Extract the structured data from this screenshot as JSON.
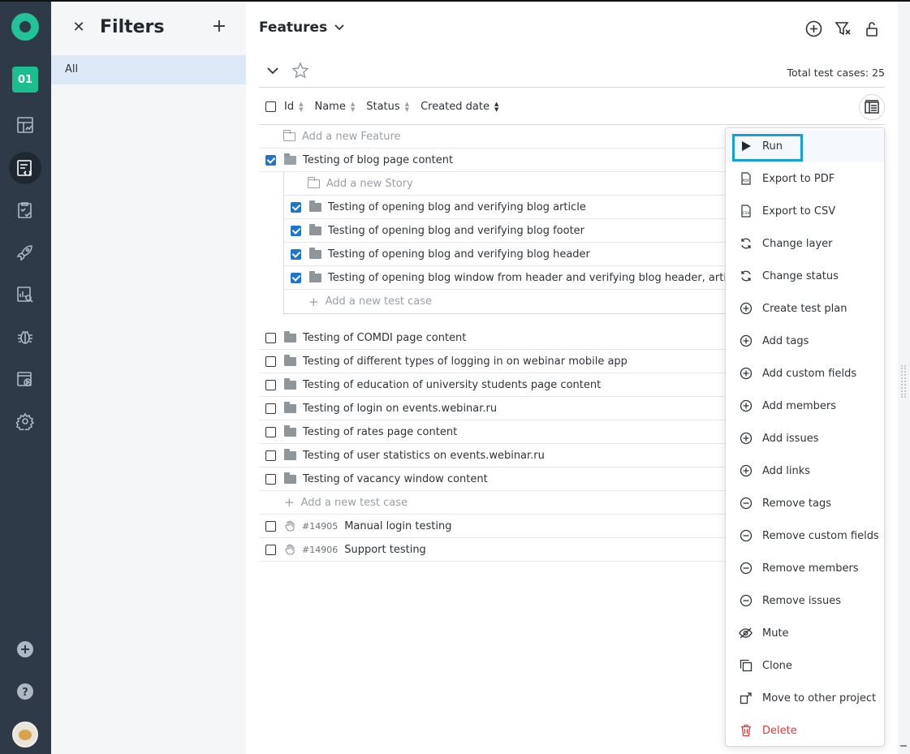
{
  "filters": {
    "title": "Filters",
    "items": [
      {
        "label": "All"
      }
    ]
  },
  "project": {
    "badge": "01"
  },
  "header": {
    "title": "Features"
  },
  "toolbar": {
    "total_label": "Total test cases: 25"
  },
  "columns": {
    "id": "Id",
    "name": "Name",
    "status": "Status",
    "created": "Created date"
  },
  "tree": {
    "add_feature": "Add a new Feature",
    "blog": {
      "label": "Testing of blog page content",
      "add_story": "Add a new Story",
      "items": [
        "Testing of opening blog and verifying blog article",
        "Testing of opening blog and verifying blog footer",
        "Testing of opening blog and verifying blog header",
        "Testing of opening blog window from header and verifying blog header, article a"
      ],
      "add_case": "Add a new test case"
    },
    "features": [
      "Testing of COMDI page content",
      "Testing of different types of logging in on webinar mobile app",
      "Testing of education of university students page content",
      "Testing of login on events.webinar.ru",
      "Testing of rates page content",
      "Testing of user statistics on events.webinar.ru",
      "Testing of vacancy window content"
    ],
    "add_case": "Add a new test case",
    "cases": [
      {
        "id": "#14905",
        "name": "Manual login testing"
      },
      {
        "id": "#14906",
        "name": "Support testing"
      }
    ]
  },
  "menu": {
    "items": [
      {
        "label": "Run",
        "icon": "play-icon"
      },
      {
        "label": "Export to PDF",
        "icon": "pdf-icon"
      },
      {
        "label": "Export to CSV",
        "icon": "csv-icon"
      },
      {
        "label": "Change layer",
        "icon": "refresh-icon"
      },
      {
        "label": "Change status",
        "icon": "refresh-icon"
      },
      {
        "label": "Create test plan",
        "icon": "plus-circle-icon"
      },
      {
        "label": "Add tags",
        "icon": "plus-circle-icon"
      },
      {
        "label": "Add custom fields",
        "icon": "plus-circle-icon"
      },
      {
        "label": "Add members",
        "icon": "plus-circle-icon"
      },
      {
        "label": "Add issues",
        "icon": "plus-circle-icon"
      },
      {
        "label": "Add links",
        "icon": "plus-circle-icon"
      },
      {
        "label": "Remove tags",
        "icon": "minus-circle-icon"
      },
      {
        "label": "Remove custom fields",
        "icon": "minus-circle-icon"
      },
      {
        "label": "Remove members",
        "icon": "minus-circle-icon"
      },
      {
        "label": "Remove issues",
        "icon": "minus-circle-icon"
      },
      {
        "label": "Mute",
        "icon": "eye-off-icon"
      },
      {
        "label": "Clone",
        "icon": "clone-icon"
      },
      {
        "label": "Move to other project",
        "icon": "move-icon"
      },
      {
        "label": "Delete",
        "icon": "trash-icon"
      }
    ]
  },
  "colors": {
    "rail": "#2e3a47",
    "accent": "#1bbf8f",
    "selected": "#dce8f6",
    "check": "#1f75cb",
    "danger": "#e0393e"
  }
}
